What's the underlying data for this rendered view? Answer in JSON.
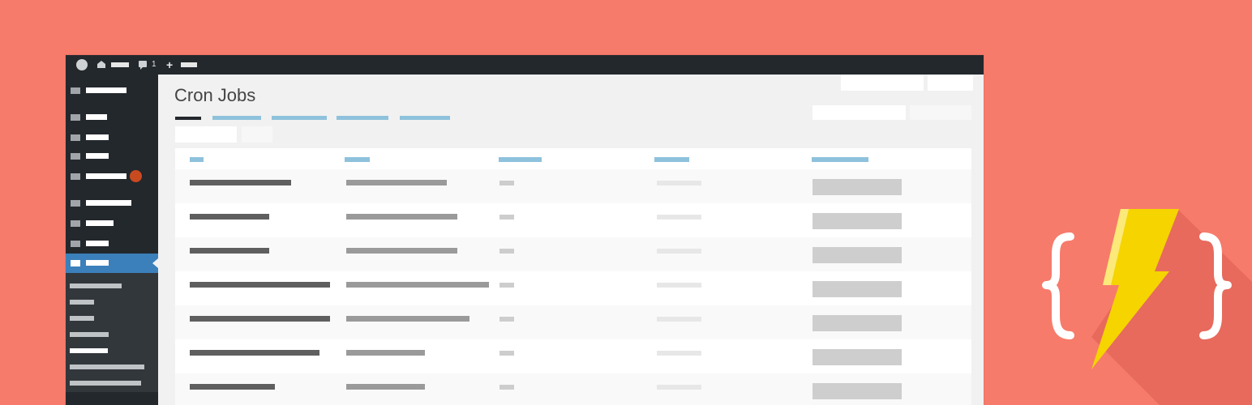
{
  "admin_bar": {
    "comment_count": "1",
    "new_label": "+"
  },
  "page": {
    "title": "Cron Jobs"
  },
  "colors": {
    "background": "#f67b6b",
    "admin_dark": "#23282d",
    "admin_accent": "#3b80bb",
    "link_blue": "#8ec2dc",
    "badge_orange": "#ca4a1f",
    "bolt_yellow": "#f5d400"
  },
  "icons": [
    "wordpress-icon",
    "home-icon",
    "comment-icon",
    "plus-icon",
    "lightning-bolt-icon",
    "curly-braces-icon"
  ],
  "table": {
    "columns": 5,
    "rows": 7
  }
}
